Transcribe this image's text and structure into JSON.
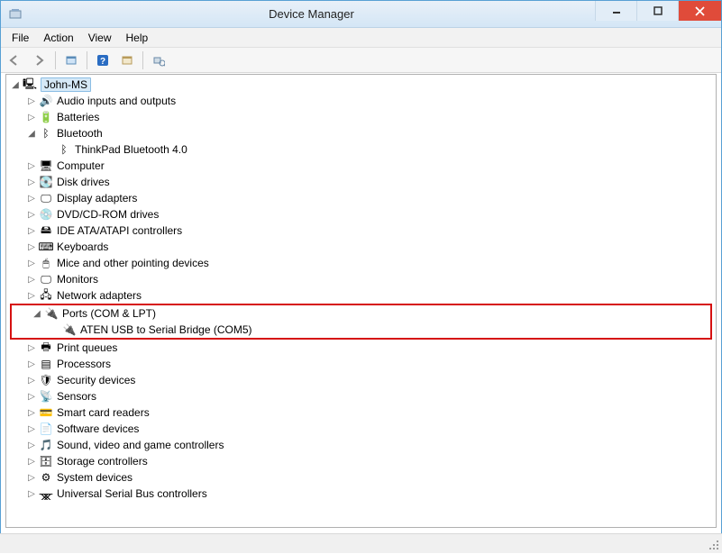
{
  "window": {
    "title": "Device Manager"
  },
  "menu": {
    "file": "File",
    "action": "Action",
    "view": "View",
    "help": "Help"
  },
  "tree": {
    "root": "John-MS",
    "items": [
      {
        "label": "Audio inputs and outputs",
        "icon": "speaker",
        "exp": "▷"
      },
      {
        "label": "Batteries",
        "icon": "battery",
        "exp": "▷"
      },
      {
        "label": "Bluetooth",
        "icon": "bluetooth",
        "exp": "◢",
        "children": [
          {
            "label": "ThinkPad Bluetooth 4.0",
            "icon": "bluetooth"
          }
        ]
      },
      {
        "label": "Computer",
        "icon": "computer",
        "exp": "▷"
      },
      {
        "label": "Disk drives",
        "icon": "disk",
        "exp": "▷"
      },
      {
        "label": "Display adapters",
        "icon": "display",
        "exp": "▷"
      },
      {
        "label": "DVD/CD-ROM drives",
        "icon": "cd",
        "exp": "▷"
      },
      {
        "label": "IDE ATA/ATAPI controllers",
        "icon": "ide",
        "exp": "▷"
      },
      {
        "label": "Keyboards",
        "icon": "keyboard",
        "exp": "▷"
      },
      {
        "label": "Mice and other pointing devices",
        "icon": "mouse",
        "exp": "▷"
      },
      {
        "label": "Monitors",
        "icon": "monitor",
        "exp": "▷"
      },
      {
        "label": "Network adapters",
        "icon": "network",
        "exp": "▷"
      },
      {
        "label": "Ports (COM & LPT)",
        "icon": "port",
        "exp": "◢",
        "highlight": true,
        "children": [
          {
            "label": "ATEN USB to Serial Bridge (COM5)",
            "icon": "port"
          }
        ]
      },
      {
        "label": "Print queues",
        "icon": "printer",
        "exp": "▷"
      },
      {
        "label": "Processors",
        "icon": "cpu",
        "exp": "▷"
      },
      {
        "label": "Security devices",
        "icon": "shield",
        "exp": "▷"
      },
      {
        "label": "Sensors",
        "icon": "sensor",
        "exp": "▷"
      },
      {
        "label": "Smart card readers",
        "icon": "card",
        "exp": "▷"
      },
      {
        "label": "Software devices",
        "icon": "software",
        "exp": "▷"
      },
      {
        "label": "Sound, video and game controllers",
        "icon": "sound",
        "exp": "▷"
      },
      {
        "label": "Storage controllers",
        "icon": "storage",
        "exp": "▷"
      },
      {
        "label": "System devices",
        "icon": "system",
        "exp": "▷"
      },
      {
        "label": "Universal Serial Bus controllers",
        "icon": "usb",
        "exp": "▷"
      }
    ]
  },
  "icons": {
    "speaker": "🔊",
    "battery": "🔋",
    "bluetooth": "ᛒ",
    "computer": "🖥",
    "disk": "💽",
    "display": "🖵",
    "cd": "💿",
    "ide": "🖴",
    "keyboard": "⌨",
    "mouse": "🖱",
    "monitor": "🖵",
    "network": "🖧",
    "port": "🔌",
    "printer": "🖶",
    "cpu": "▤",
    "shield": "🛡",
    "sensor": "📡",
    "card": "💳",
    "software": "📄",
    "sound": "🎵",
    "storage": "🗄",
    "system": "⚙",
    "usb": "ᚘ",
    "pc": "🖳"
  }
}
